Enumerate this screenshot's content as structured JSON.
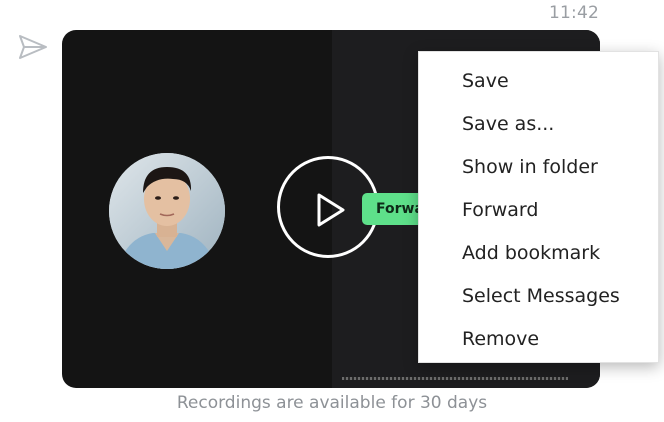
{
  "message": {
    "timestamp": "11:42",
    "caption": "Recordings are available for 30 days"
  },
  "tooltip": {
    "label": "Forward",
    "color": "#5ee08a"
  },
  "context_menu": {
    "items": [
      {
        "label": "Save"
      },
      {
        "label": "Save as..."
      },
      {
        "label": "Show in folder"
      },
      {
        "label": "Forward"
      },
      {
        "label": "Add bookmark"
      },
      {
        "label": "Select Messages"
      },
      {
        "label": "Remove"
      }
    ]
  },
  "icons": {
    "sent": "paper-plane-icon",
    "play": "play-icon"
  },
  "colors": {
    "video_background": "#141414",
    "muted_text": "#8d9196"
  }
}
